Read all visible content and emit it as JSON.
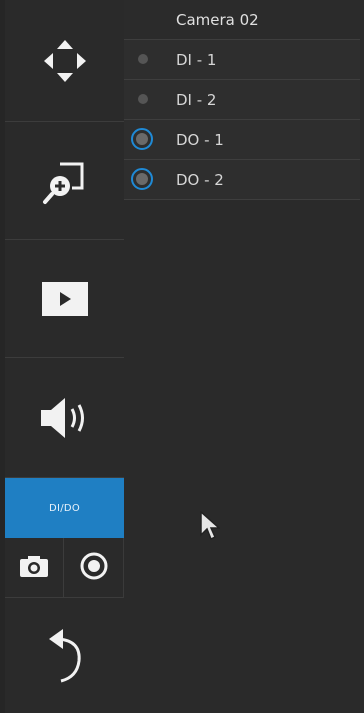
{
  "panel": {
    "camera_title": "Camera 02",
    "io_items": [
      {
        "label": "DI - 1",
        "kind": "DI"
      },
      {
        "label": "DI - 2",
        "kind": "DI"
      },
      {
        "label": "DO - 1",
        "kind": "DO"
      },
      {
        "label": "DO - 2",
        "kind": "DO"
      }
    ]
  },
  "toolbar": {
    "ptz_icon": "ptz-arrows-icon",
    "zoom_icon": "digital-zoom-icon",
    "play_icon": "play-icon",
    "audio_icon": "speaker-icon",
    "dido_label": "DI/DO",
    "snapshot_icon": "camera-icon",
    "record_icon": "record-icon",
    "back_icon": "undo-arrow-icon"
  },
  "colors": {
    "accent": "#1f7fc3",
    "ring": "#1f8ad6",
    "background": "#262626"
  }
}
